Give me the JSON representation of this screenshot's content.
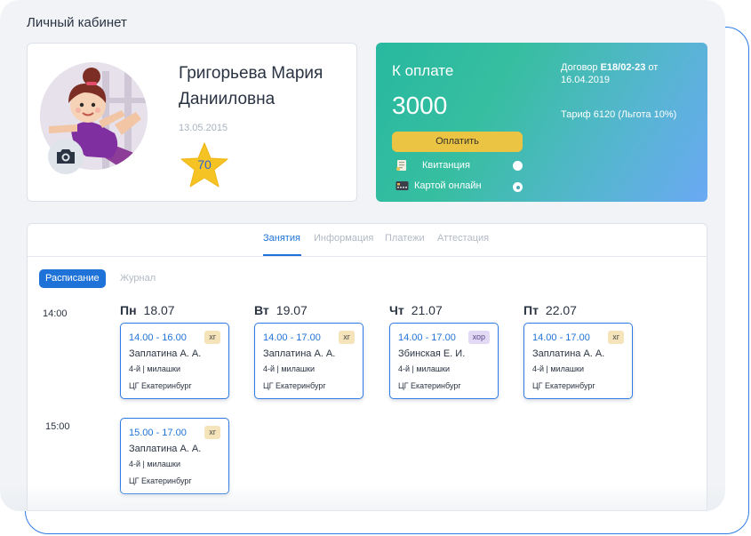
{
  "page": {
    "title": "Личный кабинет"
  },
  "profile": {
    "name_line1": "Григорьева Мария",
    "name_line2": "Данииловна",
    "dob": "13.05.2015",
    "rating": "70",
    "avatar_icon": "child-avatar-illustration",
    "camera_icon": "camera-icon"
  },
  "payment": {
    "title": "К оплате",
    "amount": "3000",
    "pay_button": "Оплатить",
    "options": [
      {
        "label": "Квитанция",
        "icon": "receipt-icon",
        "selected": false
      },
      {
        "label": "Картой онлайн",
        "icon": "card-icon",
        "selected": true
      }
    ],
    "contract_prefix": "Договор ",
    "contract_number": "Е18/02-23",
    "contract_suffix": " от 16.04.2019",
    "tariff": "Тариф 6120 (Льгота 10%)",
    "colors": {
      "gradient_start": "#27b9a0",
      "gradient_end": "#6aa9f3",
      "button": "#ecc443"
    }
  },
  "tabs": [
    {
      "label": "Занятия",
      "active": true
    },
    {
      "label": "Информация",
      "active": false
    },
    {
      "label": "Платежи",
      "active": false
    },
    {
      "label": "Аттестация",
      "active": false
    }
  ],
  "subtabs": [
    {
      "label": "Расписание",
      "active": true
    },
    {
      "label": "Журнал",
      "active": false
    }
  ],
  "schedule": {
    "time_slots": [
      "14:00",
      "15:00"
    ],
    "days": [
      {
        "abbr": "Пн",
        "date": "18.07"
      },
      {
        "abbr": "Вт",
        "date": "19.07"
      },
      {
        "abbr": "Чт",
        "date": "21.07"
      },
      {
        "abbr": "Пт",
        "date": "22.07"
      }
    ],
    "lessons": [
      {
        "time": "14.00 - 16.00",
        "tag": "хг",
        "teacher": "Заплатина А. А.",
        "group": "4-й | милашки",
        "place": "ЦГ Екатеринбург"
      },
      {
        "time": "14.00 - 17.00",
        "tag": "хг",
        "teacher": "Заплатина А. А.",
        "group": "4-й | милашки",
        "place": "ЦГ Екатеринбург"
      },
      {
        "time": "14.00 - 17.00",
        "tag": "хор",
        "teacher": "Збинская Е. И.",
        "group": "4-й | милашки",
        "place": "ЦГ Екатеринбург"
      },
      {
        "time": "14.00 - 17.00",
        "tag": "хг",
        "teacher": "Заплатина А. А.",
        "group": "4-й | милашки",
        "place": "ЦГ Екатеринбург"
      },
      {
        "time": "15.00 - 17.00",
        "tag": "хг",
        "teacher": "Заплатина А. А.",
        "group": "4-й | милашки",
        "place": "ЦГ Екатеринбург"
      }
    ]
  },
  "colors": {
    "accent": "#1f73d8",
    "background": "#f1f3f6"
  }
}
